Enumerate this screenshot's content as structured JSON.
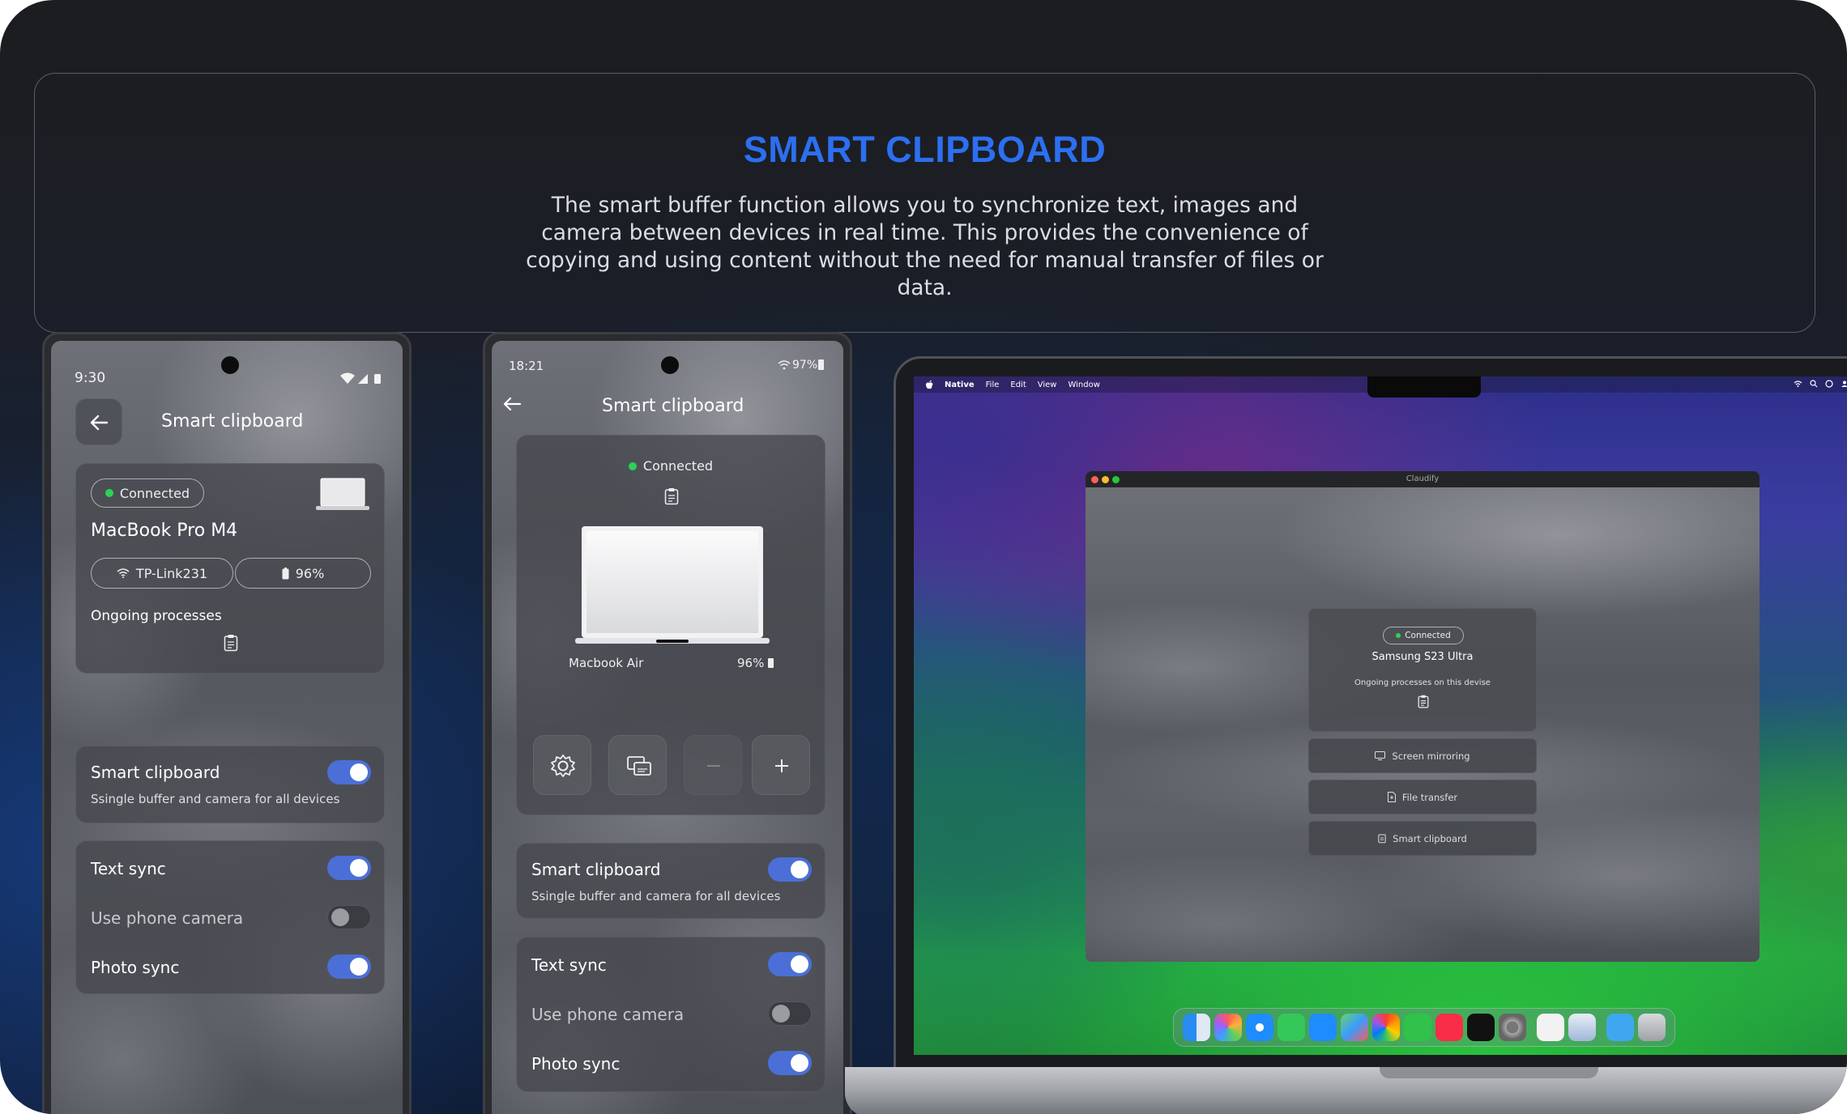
{
  "hero": {
    "title": "SMART CLIPBOARD",
    "description": "The smart buffer function allows you to synchronize text, images and camera between devices in real time. This provides the convenience of copying and using content without the need for manual transfer of files or data."
  },
  "phone1": {
    "time": "9:30",
    "title": "Smart clipboard",
    "status": "Connected",
    "device": "MacBook Pro M4",
    "wifi": "TP-Link231",
    "battery": "96%",
    "ongoing": "Ongoing processes",
    "smart_title": "Smart clipboard",
    "smart_sub": "Ssingle buffer and camera for all devices",
    "text_sync": "Text sync",
    "use_camera": "Use phone camera",
    "photo_sync": "Photo sync"
  },
  "phone2": {
    "time": "18:21",
    "battery_status": "97%",
    "title": "Smart clipboard",
    "status": "Connected",
    "device": "Macbook Air",
    "battery": "96%",
    "smart_title": "Smart clipboard",
    "smart_sub": "Ssingle buffer and camera for all devices",
    "text_sync": "Text sync",
    "use_camera": "Use phone camera",
    "photo_sync": "Photo sync"
  },
  "mac": {
    "menu": [
      "Native",
      "File",
      "Edit",
      "View",
      "Window"
    ],
    "window_title": "Claudify",
    "status": "Connected",
    "device": "Samsung S23 Ultra",
    "ongoing": "Ongoing processes on this devise",
    "btn_mirroring": "Screen mirroring",
    "btn_transfer": "File transfer",
    "btn_clipboard": "Smart clipboard"
  },
  "colors": {
    "accent": "#2c6ff0",
    "toggle_on": "#4b6fd6",
    "connected": "#2bd354"
  }
}
